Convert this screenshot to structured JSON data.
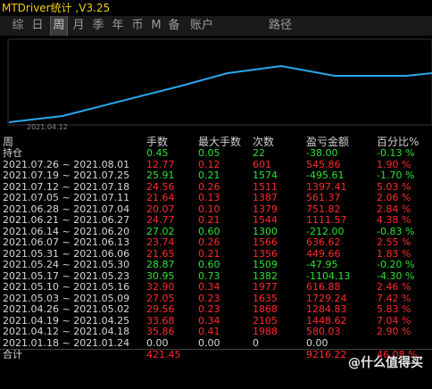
{
  "app": {
    "title": "MTDriver统计 ,V3.25"
  },
  "tabs": [
    {
      "label": "综",
      "active": false
    },
    {
      "label": "日",
      "active": false
    },
    {
      "label": "周",
      "active": true
    },
    {
      "label": "月",
      "active": false
    },
    {
      "label": "季",
      "active": false
    },
    {
      "label": "年",
      "active": false
    },
    {
      "label": "币",
      "active": false
    },
    {
      "label": "M",
      "active": false
    },
    {
      "label": "备",
      "active": false
    },
    {
      "label": "账户",
      "active": false
    },
    {
      "label": "路径",
      "active": false
    }
  ],
  "chart": {
    "date_label": "2021.04.12",
    "line_color": "#29a8f0"
  },
  "table": {
    "headers": [
      "周",
      "手数",
      "最大手数",
      "次数",
      "盈亏金额",
      "百分比%"
    ],
    "holding": {
      "label": "持仓",
      "lots": "0.45",
      "max": "0.05",
      "count": "22",
      "pnl": "-38.00",
      "pct": "-0.13 %",
      "color": "g"
    },
    "rows": [
      {
        "period": "2021.07.26 ~ 2021.08.01",
        "lots": "12.77",
        "max": "0.12",
        "count": "601",
        "pnl": "545.86",
        "pct": "1.90 %",
        "color": "r"
      },
      {
        "period": "2021.07.19 ~ 2021.07.25",
        "lots": "25.91",
        "max": "0.21",
        "count": "1574",
        "pnl": "-495.61",
        "pct": "-1.70 %",
        "color": "g"
      },
      {
        "period": "2021.07.12 ~ 2021.07.18",
        "lots": "24.56",
        "max": "0.26",
        "count": "1511",
        "pnl": "1397.41",
        "pct": "5.03 %",
        "color": "r"
      },
      {
        "period": "2021.07.05 ~ 2021.07.11",
        "lots": "21.64",
        "max": "0.13",
        "count": "1387",
        "pnl": "561.37",
        "pct": "2.06 %",
        "color": "r"
      },
      {
        "period": "2021.06.28 ~ 2021.07.04",
        "lots": "20.07",
        "max": "0.10",
        "count": "1379",
        "pnl": "751.82",
        "pct": "2.84 %",
        "color": "r"
      },
      {
        "period": "2021.06.21 ~ 2021.06.27",
        "lots": "24.77",
        "max": "0.21",
        "count": "1544",
        "pnl": "1111.57",
        "pct": "4.38 %",
        "color": "r"
      },
      {
        "period": "2021.06.14 ~ 2021.06.20",
        "lots": "27.02",
        "max": "0.60",
        "count": "1300",
        "pnl": "-212.00",
        "pct": "-0.83 %",
        "color": "g"
      },
      {
        "period": "2021.06.07 ~ 2021.06.13",
        "lots": "23.74",
        "max": "0.26",
        "count": "1566",
        "pnl": "636.62",
        "pct": "2.55 %",
        "color": "r"
      },
      {
        "period": "2021.05.31 ~ 2021.06.06",
        "lots": "21.65",
        "max": "0.21",
        "count": "1356",
        "pnl": "449.66",
        "pct": "1.83 %",
        "color": "r"
      },
      {
        "period": "2021.05.24 ~ 2021.05.30",
        "lots": "28.87",
        "max": "0.60",
        "count": "1509",
        "pnl": "-47.95",
        "pct": "-0.20 %",
        "color": "g"
      },
      {
        "period": "2021.05.17 ~ 2021.05.23",
        "lots": "30.95",
        "max": "0.73",
        "count": "1382",
        "pnl": "-1104.13",
        "pct": "-4.30 %",
        "color": "g"
      },
      {
        "period": "2021.05.10 ~ 2021.05.16",
        "lots": "32.90",
        "max": "0.34",
        "count": "1977",
        "pnl": "616.88",
        "pct": "2.46 %",
        "color": "r"
      },
      {
        "period": "2021.05.03 ~ 2021.05.09",
        "lots": "27.05",
        "max": "0.23",
        "count": "1635",
        "pnl": "1729.24",
        "pct": "7.42 %",
        "color": "r"
      },
      {
        "period": "2021.04.26 ~ 2021.05.02",
        "lots": "29.56",
        "max": "0.23",
        "count": "1868",
        "pnl": "1284.83",
        "pct": "5.83 %",
        "color": "r"
      },
      {
        "period": "2021.04.19 ~ 2021.04.25",
        "lots": "33.68",
        "max": "0.34",
        "count": "2105",
        "pnl": "1448.62",
        "pct": "7.04 %",
        "color": "r"
      },
      {
        "period": "2021.04.12 ~ 2021.04.18",
        "lots": "35.86",
        "max": "0.41",
        "count": "1988",
        "pnl": "580.03",
        "pct": "2.90 %",
        "color": "r"
      },
      {
        "period": "2021.01.18 ~ 2021.01.24",
        "lots": "0.00",
        "max": "0.00",
        "count": "0",
        "pnl": "0.00",
        "pct": "",
        "color": "w"
      }
    ],
    "total": {
      "label": "合计",
      "lots": "421.45",
      "max": "",
      "count": "",
      "pnl": "9216.22",
      "pct": "46.08 %",
      "color": "r"
    }
  },
  "watermark": "@什么值得买"
}
